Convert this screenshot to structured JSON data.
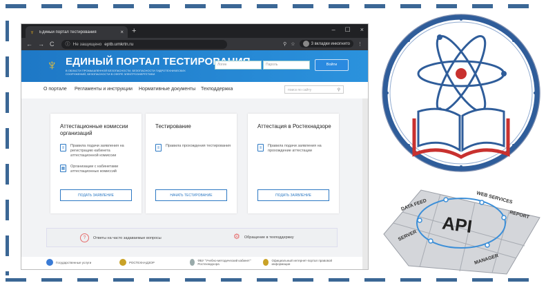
{
  "browser": {
    "tab_title": "Единый портал тестирования",
    "tab_close": "×",
    "new_tab": "+",
    "window_controls": [
      "–",
      "☐",
      "×"
    ],
    "nav_icons": [
      "←",
      "→",
      "C"
    ],
    "security_label": "Не защищено",
    "url": "eptb.umkrtn.ru",
    "incognito_label": "3 вкладки инкогнито",
    "icons": [
      "search-icon",
      "star-icon",
      "incognito-icon",
      "menu-icon"
    ]
  },
  "site": {
    "title": "ЕДИНЫЙ ПОРТАЛ ТЕСТИРОВАНИЯ",
    "subtitle": "В ОБЛАСТИ ПРОМЫШЛЕННОЙ БЕЗОПАСНОСТИ, БЕЗОПАСНОСТИ ГИДРОТЕХНИЧЕСКИХ СООРУЖЕНИЙ, БЕЗОПАСНОСТИ В СФЕРЕ ЭЛЕКТРОЭНЕРГЕТИКИ",
    "login_placeholder": "Логин",
    "password_placeholder": "Пароль",
    "login_button": "Войти",
    "nav": [
      "О портале",
      "Регламенты и инструкции",
      "Нормативные документы",
      "Техподдержка"
    ],
    "search_placeholder": "поиск по сайту"
  },
  "cards": [
    {
      "title": "Аттестационные комиссии организаций",
      "items": [
        "Правила подачи заявления на регистрацию кабинета аттестационной комиссии",
        "Организации с кабинетами аттестационных комиссий"
      ],
      "button": "ПОДАТЬ ЗАЯВЛЕНИЕ"
    },
    {
      "title": "Тестирование",
      "items": [
        "Правила прохождения тестирования"
      ],
      "button": "НАЧАТЬ ТЕСТИРОВАНИЕ"
    },
    {
      "title": "Аттестация в Ростехнадзоре",
      "items": [
        "Правила подачи заявления на прохождение аттестации"
      ],
      "button": "ПОДАТЬ ЗАЯВЛЕНИЕ"
    }
  ],
  "faq": {
    "questions": "Ответы на часто задаваемые вопросы",
    "support": "Обращение в техподдержку"
  },
  "footer": [
    "Государственные услуги",
    "РОСТЕХНАДЗОР",
    "ФБУ \"Учебно-методический кабинет\" Ростехнадзора",
    "Официальный интернет-портал правовой информации"
  ],
  "puzzle_labels": [
    "DATA FEED",
    "WEB SERVICES",
    "REPORT",
    "API",
    "SERVER",
    "MANAGER"
  ],
  "colors": {
    "frame": "#3b6795",
    "header_blue": "#1e78c6",
    "logo_blue": "#2f5d9a",
    "logo_red": "#c8312f"
  }
}
